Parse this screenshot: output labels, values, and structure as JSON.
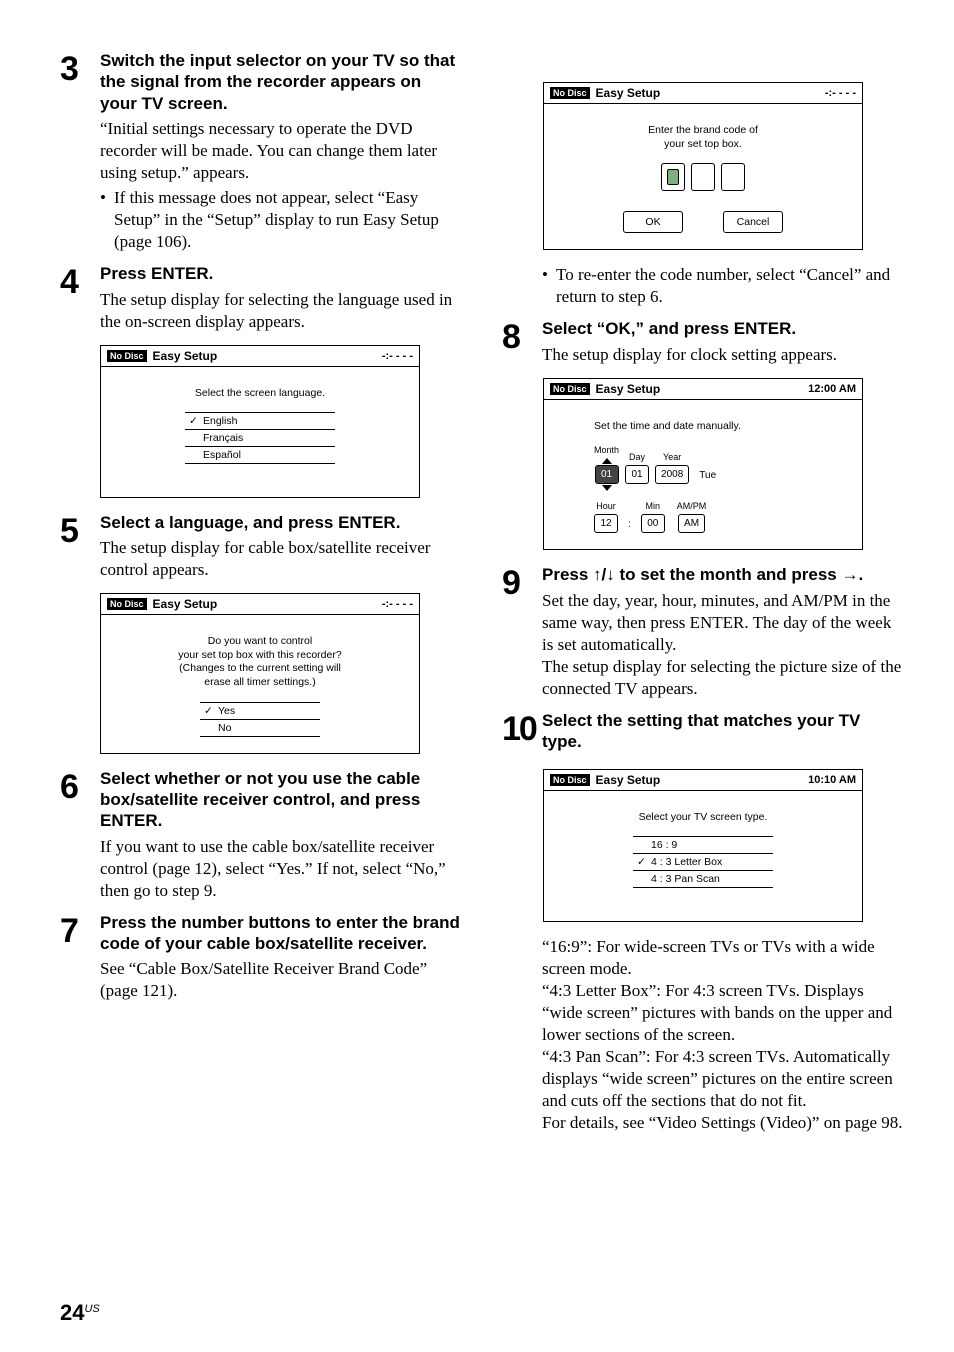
{
  "page_number": "24",
  "page_region": "US",
  "steps": {
    "s3": {
      "num": "3",
      "head": "Switch the input selector on your TV so that the signal from the recorder appears on your TV screen.",
      "desc": "“Initial settings necessary to operate the DVD recorder will be made. You can change them later using setup.” appears.",
      "bullet": "If this message does not appear, select “Easy Setup” in the “Setup” display to run Easy Setup (page 106)."
    },
    "s4": {
      "num": "4",
      "head": "Press ENTER.",
      "desc": "The setup display for selecting the language used in the on-screen display appears."
    },
    "s5": {
      "num": "5",
      "head": "Select a language, and press ENTER.",
      "desc": "The setup display for cable box/satellite receiver control appears."
    },
    "s6": {
      "num": "6",
      "head": "Select whether or not you use the cable box/satellite receiver control, and press ENTER.",
      "desc": "If you want to use the cable box/satellite receiver control (page 12), select “Yes.” If not, select “No,” then go to step 9."
    },
    "s7": {
      "num": "7",
      "head": "Press the number buttons to enter the brand code of your cable box/satellite receiver.",
      "desc": "See “Cable Box/Satellite Receiver Brand Code” (page 121)."
    },
    "s7b": {
      "bullet": "To re-enter the code number, select “Cancel” and return to step 6."
    },
    "s8": {
      "num": "8",
      "head": "Select “OK,” and press ENTER.",
      "desc": "The setup display for clock setting appears."
    },
    "s9": {
      "num": "9",
      "head_pre": "Press ",
      "head_post": " to set the month and press ",
      "head_end": ".",
      "desc": "Set the day, year, hour, minutes, and AM/PM in the same way, then press ENTER. The day of the week is set automatically.\nThe setup display for selecting the picture size of the connected TV appears."
    },
    "s10": {
      "num": "10",
      "head": "Select the setting that matches your TV type.",
      "desc": "“16:9”: For wide-screen TVs or TVs with a wide screen mode.\n“4:3 Letter Box”: For 4:3 screen TVs. Displays “wide screen” pictures with bands on the upper and lower sections of the screen.\n“4:3 Pan Scan”: For 4:3 screen TVs. Automatically displays “wide screen” pictures on the entire screen and cuts off the sections that do not fit.\nFor details, see “Video Settings (Video)” on page 98."
    }
  },
  "screens": {
    "common": {
      "nodisc": "No Disc",
      "title": "Easy Setup",
      "time_dash": "-:- - - -"
    },
    "lang": {
      "msg": "Select the screen language.",
      "opts": [
        "English",
        "Français",
        "Español"
      ],
      "sel_index": 0
    },
    "control": {
      "msg": "Do you want to control\nyour set top box with this recorder?\n(Changes to the current setting will\nerase all timer settings.)",
      "opts": [
        "Yes",
        "No"
      ],
      "sel_index": 0
    },
    "brand": {
      "msg": "Enter the brand code of\nyour set top box.",
      "ok": "OK",
      "cancel": "Cancel"
    },
    "clock": {
      "time": "12:00 AM",
      "msg": "Set the time and date manually.",
      "labels": {
        "month": "Month",
        "day": "Day",
        "year": "Year",
        "hour": "Hour",
        "min": "Min",
        "ampm": "AM/PM"
      },
      "vals": {
        "month": "01",
        "day": "01",
        "year": "2008",
        "dayname": "Tue",
        "hour": "12",
        "min": "00",
        "ampm": "AM"
      }
    },
    "tvtype": {
      "time": "10:10 AM",
      "msg": "Select your TV screen type.",
      "opts": [
        "16 : 9",
        "4 : 3  Letter Box",
        "4 : 3  Pan Scan"
      ],
      "sel_index": 1
    }
  }
}
